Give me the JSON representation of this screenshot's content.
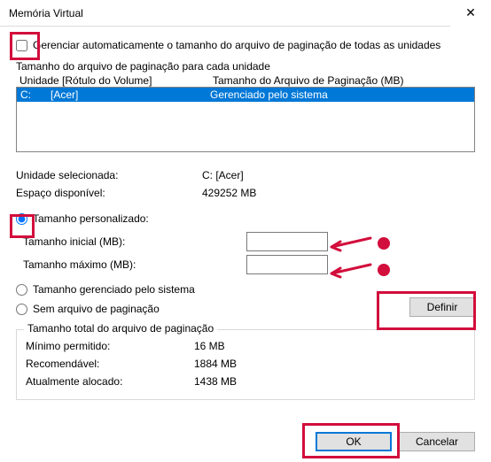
{
  "title": "Memória Virtual",
  "auto_manage_label": "Gerenciar automaticamente o tamanho do arquivo de paginação de todas as unidades",
  "per_drive_label": "Tamanho do arquivo de paginação para cada unidade",
  "columns": {
    "drive": "Unidade [Rótulo do Volume]",
    "size": "Tamanho do Arquivo de Paginação (MB)"
  },
  "drives": [
    {
      "letter": "C:",
      "label": "[Acer]",
      "status": "Gerenciado pelo sistema"
    }
  ],
  "selected_drive": {
    "label_txt": "Unidade selecionada:",
    "value": "C:  [Acer]"
  },
  "space_available": {
    "label_txt": "Espaço disponível:",
    "value": "429252 MB"
  },
  "custom_size_label": "Tamanho personalizado:",
  "initial_size_label": "Tamanho inicial (MB):",
  "max_size_label": "Tamanho máximo (MB):",
  "initial_size_value": "",
  "max_size_value": "",
  "system_managed_label": "Tamanho gerenciado pelo sistema",
  "no_paging_label": "Sem arquivo de paginação",
  "set_button": "Definir",
  "total_group_label": "Tamanho total do arquivo de paginação",
  "min_allowed": {
    "label_txt": "Mínimo permitido:",
    "value": "16 MB"
  },
  "recommended": {
    "label_txt": "Recomendável:",
    "value": "1884 MB"
  },
  "allocated": {
    "label_txt": "Atualmente alocado:",
    "value": "1438 MB"
  },
  "ok_button": "OK",
  "cancel_button": "Cancelar"
}
